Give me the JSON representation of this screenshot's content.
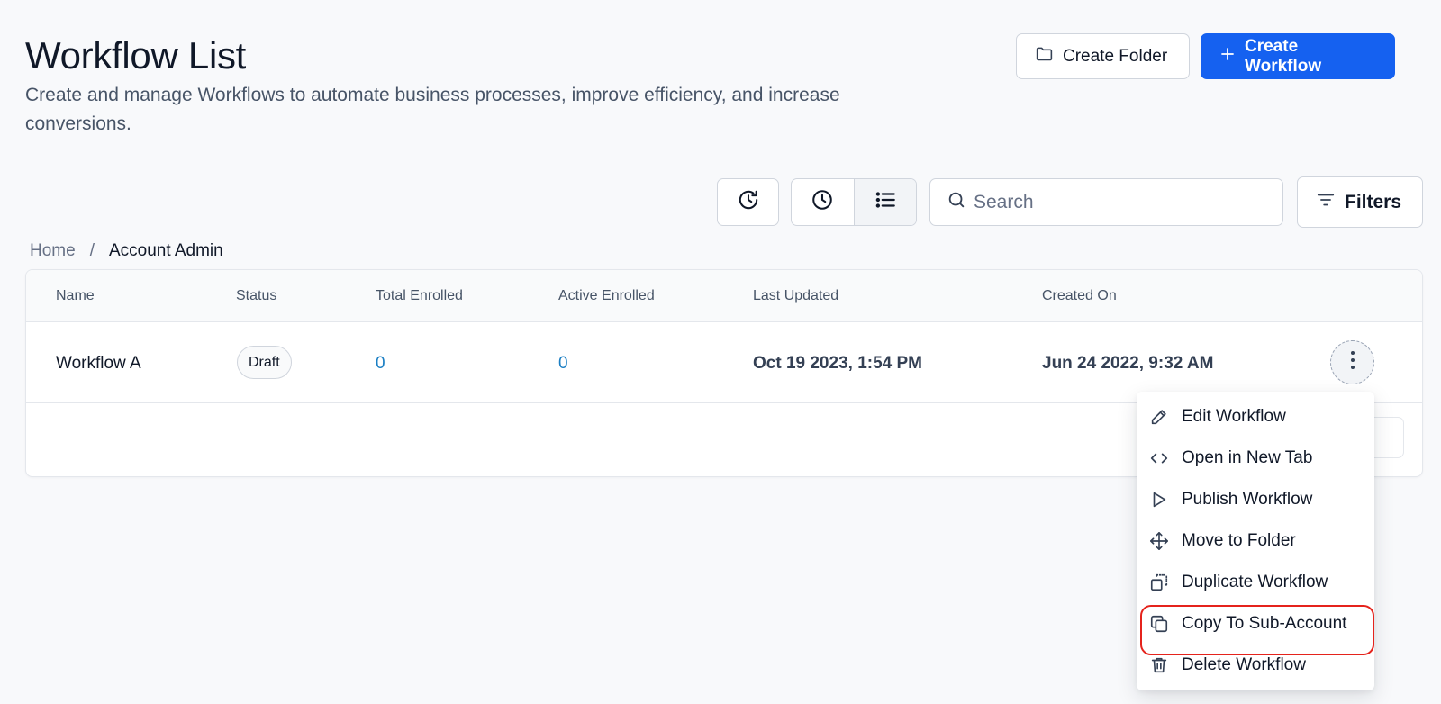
{
  "header": {
    "title": "Workflow List",
    "subtitle": "Create and manage Workflows to automate business processes, improve efficiency, and increase conversions.",
    "create_folder_label": "Create Folder",
    "create_workflow_label": "Create Workflow"
  },
  "toolbar": {
    "search_placeholder": "Search",
    "filters_label": "Filters"
  },
  "breadcrumb": {
    "home": "Home",
    "separator": "/",
    "current": "Account Admin"
  },
  "table": {
    "columns": [
      "Name",
      "Status",
      "Total Enrolled",
      "Active Enrolled",
      "Last Updated",
      "Created On"
    ],
    "rows": [
      {
        "name": "Workflow A",
        "status": "Draft",
        "total_enrolled": "0",
        "active_enrolled": "0",
        "last_updated": "Oct 19 2023, 1:54 PM",
        "created_on": "Jun 24 2022, 9:32 AM"
      }
    ]
  },
  "context_menu": {
    "items": [
      {
        "label": "Edit Workflow",
        "icon": "pencil-icon"
      },
      {
        "label": "Open in New Tab",
        "icon": "code-brackets-icon"
      },
      {
        "label": "Publish Workflow",
        "icon": "play-icon"
      },
      {
        "label": "Move to Folder",
        "icon": "move-arrows-icon"
      },
      {
        "label": "Duplicate Workflow",
        "icon": "duplicate-icon"
      },
      {
        "label": "Copy To Sub-Account",
        "icon": "copy-icon",
        "highlighted": true
      },
      {
        "label": "Delete Workflow",
        "icon": "trash-icon"
      }
    ]
  },
  "colors": {
    "primary": "#1561f0",
    "link_number": "#1b7fc4",
    "highlight_ring": "#e5231c"
  }
}
